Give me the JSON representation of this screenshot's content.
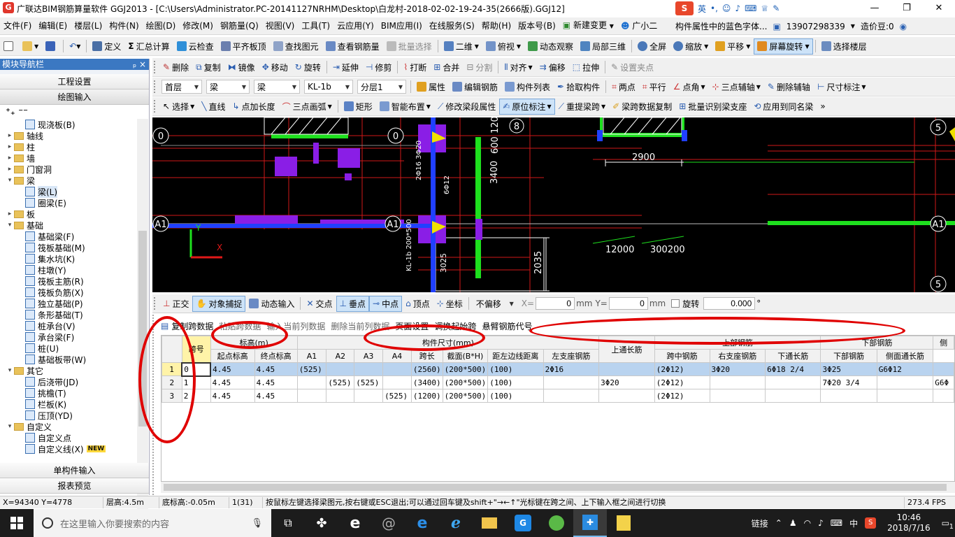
{
  "window": {
    "title": "广联达BIM钢筋算量软件 GGJ2013 - [C:\\Users\\Administrator.PC-20141127NRHM\\Desktop\\白龙村-2018-02-02-19-24-35(2666版).GGJ12]",
    "ime_label": "英",
    "min": "—",
    "max": "❐",
    "close": "✕"
  },
  "menu": {
    "items": [
      "文件(F)",
      "编辑(E)",
      "楼层(L)",
      "构件(N)",
      "绘图(D)",
      "修改(M)",
      "钢筋量(Q)",
      "视图(V)",
      "工具(T)",
      "云应用(Y)",
      "BIM应用(I)",
      "在线服务(S)",
      "帮助(H)",
      "版本号(B)",
      "新建变更",
      "广小二"
    ],
    "notice": "构件属性中的蓝色字体...",
    "phone": "13907298339",
    "coins": "造价豆:0"
  },
  "toolbar1": [
    "定义",
    "汇总计算",
    "云检查",
    "平齐板顶",
    "查找图元",
    "查看钢筋量",
    "批量选择",
    "二维",
    "俯视",
    "动态观察",
    "局部三维",
    "全屏",
    "缩放",
    "平移",
    "屏幕旋转",
    "选择楼层"
  ],
  "toolbar2": [
    "删除",
    "复制",
    "镜像",
    "移动",
    "旋转",
    "延伸",
    "修剪",
    "打断",
    "合并",
    "分割",
    "对齐",
    "偏移",
    "拉伸",
    "设置夹点"
  ],
  "toolbar3": {
    "floor": "首层",
    "type1": "梁",
    "type2": "梁",
    "member": "KL-1b",
    "layer": "分层1",
    "buttons": [
      "属性",
      "编辑钢筋",
      "构件列表",
      "拾取构件",
      "两点",
      "平行",
      "点角",
      "三点辅轴",
      "删除辅轴",
      "尺寸标注"
    ]
  },
  "toolbar4": [
    "选择",
    "直线",
    "点加长度",
    "三点画弧",
    "矩形",
    "智能布置",
    "修改梁段属性",
    "原位标注",
    "重提梁跨",
    "梁跨数据复制",
    "批量识别梁支座",
    "应用到同名梁"
  ],
  "left_panel": {
    "header": "模块导航栏",
    "pin": "ₚ  ×",
    "sections": [
      "工程设置",
      "绘图输入"
    ],
    "bottom_sections": [
      "单构件输入",
      "报表预览"
    ],
    "tree": [
      {
        "label": "现浇板(B)",
        "level": 2,
        "icon": "node"
      },
      {
        "label": "轴线",
        "level": 1,
        "icon": "folder",
        "exp": "▸"
      },
      {
        "label": "柱",
        "level": 1,
        "icon": "folder",
        "exp": "▸"
      },
      {
        "label": "墙",
        "level": 1,
        "icon": "folder",
        "exp": "▸"
      },
      {
        "label": "门窗洞",
        "level": 1,
        "icon": "folder",
        "exp": "▸"
      },
      {
        "label": "梁",
        "level": 1,
        "icon": "folder",
        "exp": "▾"
      },
      {
        "label": "梁(L)",
        "level": 2,
        "icon": "node",
        "sel": true
      },
      {
        "label": "圈梁(E)",
        "level": 2,
        "icon": "node"
      },
      {
        "label": "板",
        "level": 1,
        "icon": "folder",
        "exp": "▸"
      },
      {
        "label": "基础",
        "level": 1,
        "icon": "folder",
        "exp": "▾"
      },
      {
        "label": "基础梁(F)",
        "level": 2,
        "icon": "node"
      },
      {
        "label": "筏板基础(M)",
        "level": 2,
        "icon": "node"
      },
      {
        "label": "集水坑(K)",
        "level": 2,
        "icon": "node"
      },
      {
        "label": "柱墩(Y)",
        "level": 2,
        "icon": "node"
      },
      {
        "label": "筏板主筋(R)",
        "level": 2,
        "icon": "node"
      },
      {
        "label": "筏板负筋(X)",
        "level": 2,
        "icon": "node"
      },
      {
        "label": "独立基础(P)",
        "level": 2,
        "icon": "node"
      },
      {
        "label": "条形基础(T)",
        "level": 2,
        "icon": "node"
      },
      {
        "label": "桩承台(V)",
        "level": 2,
        "icon": "node"
      },
      {
        "label": "承台梁(F)",
        "level": 2,
        "icon": "node"
      },
      {
        "label": "桩(U)",
        "level": 2,
        "icon": "node"
      },
      {
        "label": "基础板带(W)",
        "level": 2,
        "icon": "node"
      },
      {
        "label": "其它",
        "level": 1,
        "icon": "folder",
        "exp": "▾"
      },
      {
        "label": "后浇带(JD)",
        "level": 2,
        "icon": "node"
      },
      {
        "label": "挑檐(T)",
        "level": 2,
        "icon": "node"
      },
      {
        "label": "栏板(K)",
        "level": 2,
        "icon": "node"
      },
      {
        "label": "压顶(YD)",
        "level": 2,
        "icon": "node"
      },
      {
        "label": "自定义",
        "level": 1,
        "icon": "folder",
        "exp": "▾"
      },
      {
        "label": "自定义点",
        "level": 2,
        "icon": "node"
      },
      {
        "label": "自定义线(X)",
        "level": 2,
        "icon": "node",
        "badge": "NEW"
      }
    ]
  },
  "canvas": {
    "labels": [
      "0",
      "0",
      "8",
      "5",
      "5",
      "A1",
      "A1",
      "A1",
      "Y",
      "X",
      "2900",
      "3400",
      "600 120",
      "12000",
      "300200",
      "2035",
      "3025",
      "KL-1b 200*500",
      "2Φ16 3Φ20",
      "6Φ12"
    ]
  },
  "snapbar": {
    "buttons": [
      "正交",
      "对象捕捉",
      "动态输入",
      "交点",
      "垂点",
      "中点",
      "顶点",
      "坐标"
    ],
    "offset": "不偏移",
    "x_label": "X=",
    "x_val": "0",
    "y_label": "Y=",
    "y_val": "0",
    "unit": "mm",
    "rotate_label": "旋转",
    "rotate_val": "0.000",
    "deg": "°"
  },
  "grid_toolbar": [
    "复制跨数据",
    "粘贴跨数据",
    "输入当前列数据",
    "删除当前列数据",
    "页面设置",
    "调换起始跨",
    "悬臂钢筋代号"
  ],
  "grid": {
    "group_headers": {
      "span": "跨号",
      "elev": "标高(m)",
      "dim": "构件尺寸(mm)",
      "top_through": "上通长筋",
      "top_bar": "上部钢筋",
      "bottom_bar": "下部钢筋",
      "side": "侧"
    },
    "col_headers": [
      "起点标高",
      "终点标高",
      "A1",
      "A2",
      "A3",
      "A4",
      "跨长",
      "截面(B*H)",
      "距左边线距离",
      "左支座钢筋",
      "跨中钢筋",
      "右支座钢筋",
      "下通长筋",
      "下部钢筋",
      "侧面通长筋",
      "侧"
    ],
    "rows": [
      {
        "rn": "1",
        "span": "0",
        "c": [
          "4.45",
          "4.45",
          "(525)",
          "",
          "",
          "",
          "(2560)",
          "(200*500)",
          "(100)",
          "2Φ16",
          "",
          "(2Φ12)",
          "3Φ20",
          "6Φ18 2/4",
          "3Φ25",
          "G6Φ12",
          ""
        ]
      },
      {
        "rn": "2",
        "span": "1",
        "c": [
          "4.45",
          "4.45",
          "",
          "(525)",
          "(525)",
          "",
          "(3400)",
          "(200*500)",
          "(100)",
          "",
          "3Φ20",
          "(2Φ12)",
          "",
          "",
          "7Φ20 3/4",
          "",
          "G6Φ"
        ]
      },
      {
        "rn": "3",
        "span": "2",
        "c": [
          "4.45",
          "4.45",
          "",
          "",
          "",
          "(525)",
          "(1200)",
          "(200*500)",
          "(100)",
          "",
          "",
          "(2Φ12)",
          "",
          "",
          "",
          "",
          ""
        ]
      }
    ]
  },
  "status": {
    "coords": "X=94340 Y=4778",
    "floor_h": "层高:4.5m",
    "base_h": "底标高:-0.05m",
    "count": "1(31)",
    "hint": "按鼠标左键选择梁图元,按右键或ESC退出;可以通过回车键及shift+\"→←↑\"光标键在跨之间、上下输入框之间进行切换",
    "fps": "273.4 FPS"
  },
  "taskbar": {
    "search_placeholder": "在这里输入你要搜索的内容",
    "link": "链接",
    "lang": "中",
    "time": "10:46",
    "date": "2018/7/16",
    "notif": "1"
  },
  "colors": {
    "accent": "#3b78c2",
    "annotation": "#e00000",
    "canvas_bg": "#000000"
  }
}
